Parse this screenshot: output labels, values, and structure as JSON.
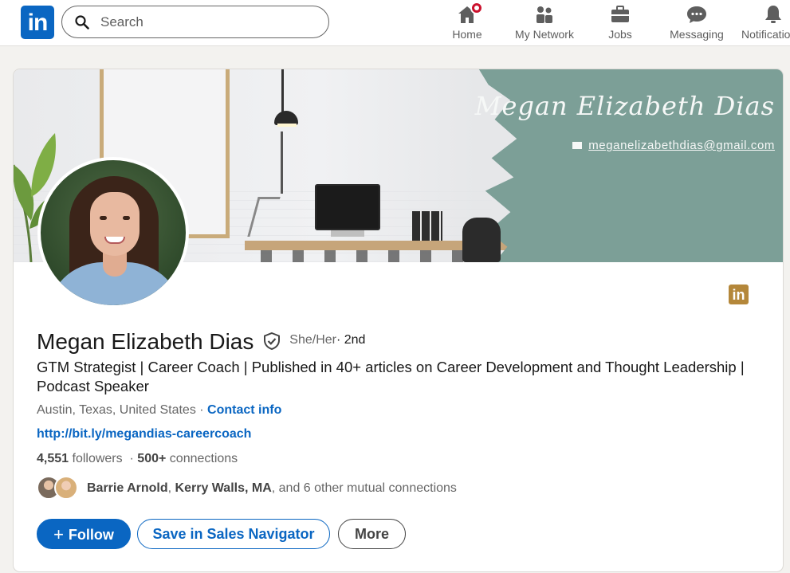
{
  "nav": {
    "logo_text": "in",
    "search_placeholder": "Search",
    "items": [
      {
        "label": "Home",
        "icon": "home-icon"
      },
      {
        "label": "My Network",
        "icon": "network-icon"
      },
      {
        "label": "Jobs",
        "icon": "briefcase-icon"
      },
      {
        "label": "Messaging",
        "icon": "message-icon"
      },
      {
        "label": "Notifications",
        "icon": "bell-icon"
      }
    ]
  },
  "banner": {
    "name": "Megan Elizabeth Dias",
    "email": "meganelizabethdias@gmail.com",
    "teal_color": "#7c9f97"
  },
  "profile": {
    "name": "Megan Elizabeth Dias",
    "pronouns": "She/Her",
    "degree": " · 2nd",
    "headline": "GTM Strategist | Career Coach | Published in 40+ articles on Career Development and Thought Leadership | Podcast Speaker",
    "location": "Austin, Texas, United States",
    "location_sep": " · ",
    "contact_label": "Contact info",
    "website": "http://bit.ly/megandias-careercoach",
    "followers_count": "4,551",
    "followers_label": " followers",
    "connections_sep": " · ",
    "connections_count": "500+",
    "connections_label": " connections",
    "mutual_name_1": "Barrie Arnold",
    "mutual_sep": ", ",
    "mutual_name_2": "Kerry Walls, MA",
    "mutual_rest": ", and 6 other mutual connections",
    "linkedin_badge_text": "in"
  },
  "actions": {
    "follow_label": "Follow",
    "follow_plus": "+",
    "sales_label": "Save in Sales Navigator",
    "more_label": "More"
  },
  "colors": {
    "brand": "#0a66c2",
    "notification": "#cb112d",
    "badge_gold": "#b4873a"
  }
}
